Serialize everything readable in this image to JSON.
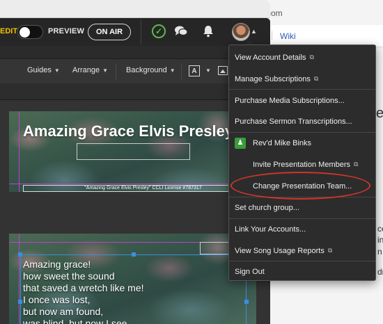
{
  "background_window": {
    "url_fragment": "com",
    "wiki_link": "Wiki",
    "side_text": [
      "e",
      "ce",
      "in",
      "n",
      "dr"
    ]
  },
  "topbar": {
    "edit_label": "EDIT",
    "preview_label": "PREVIEW",
    "on_air_label": "ON AIR"
  },
  "toolbar": {
    "guides": "Guides",
    "arrange": "Arrange",
    "background": "Background"
  },
  "slide1": {
    "title": "Amazing Grace Elvis Presley",
    "ccli": "\"Amazing Grace Elvis Presley\" CCLI License #787317"
  },
  "slide2": {
    "lines": [
      "Amazing grace!",
      "how sweet the sound",
      "that saved a wretch like me!",
      "I once was lost,",
      "but now am found,",
      "was blind, but now I see."
    ]
  },
  "menu": {
    "items": [
      {
        "label": "View Account Details",
        "external": true
      },
      {
        "label": "Manage Subscriptions",
        "external": true
      },
      {
        "label": "Purchase Media Subscriptions...",
        "external": false
      },
      {
        "label": "Purchase Sermon Transcriptions...",
        "external": false
      },
      {
        "label": "Rev'd Mike Binks",
        "external": false
      },
      {
        "label": "Invite Presentation Members",
        "external": true
      },
      {
        "label": "Change Presentation Team...",
        "external": false
      },
      {
        "label": "Set church group...",
        "external": false
      },
      {
        "label": "Link Your Accounts...",
        "external": false
      },
      {
        "label": "View Song Usage Reports",
        "external": true
      },
      {
        "label": "Sign Out",
        "external": false
      }
    ]
  },
  "colors": {
    "edit_accent": "#f2c200",
    "sync_ok": "#5dbb4a",
    "highlight_ring": "#d0342c",
    "selection": "#3a8ee0",
    "guide": "#c040d0"
  },
  "icons": [
    "check-circle-icon",
    "chat-icon",
    "bell-icon",
    "avatar",
    "chevron-down-icon",
    "text-icon",
    "image-icon",
    "external-link-icon",
    "person-icon"
  ]
}
